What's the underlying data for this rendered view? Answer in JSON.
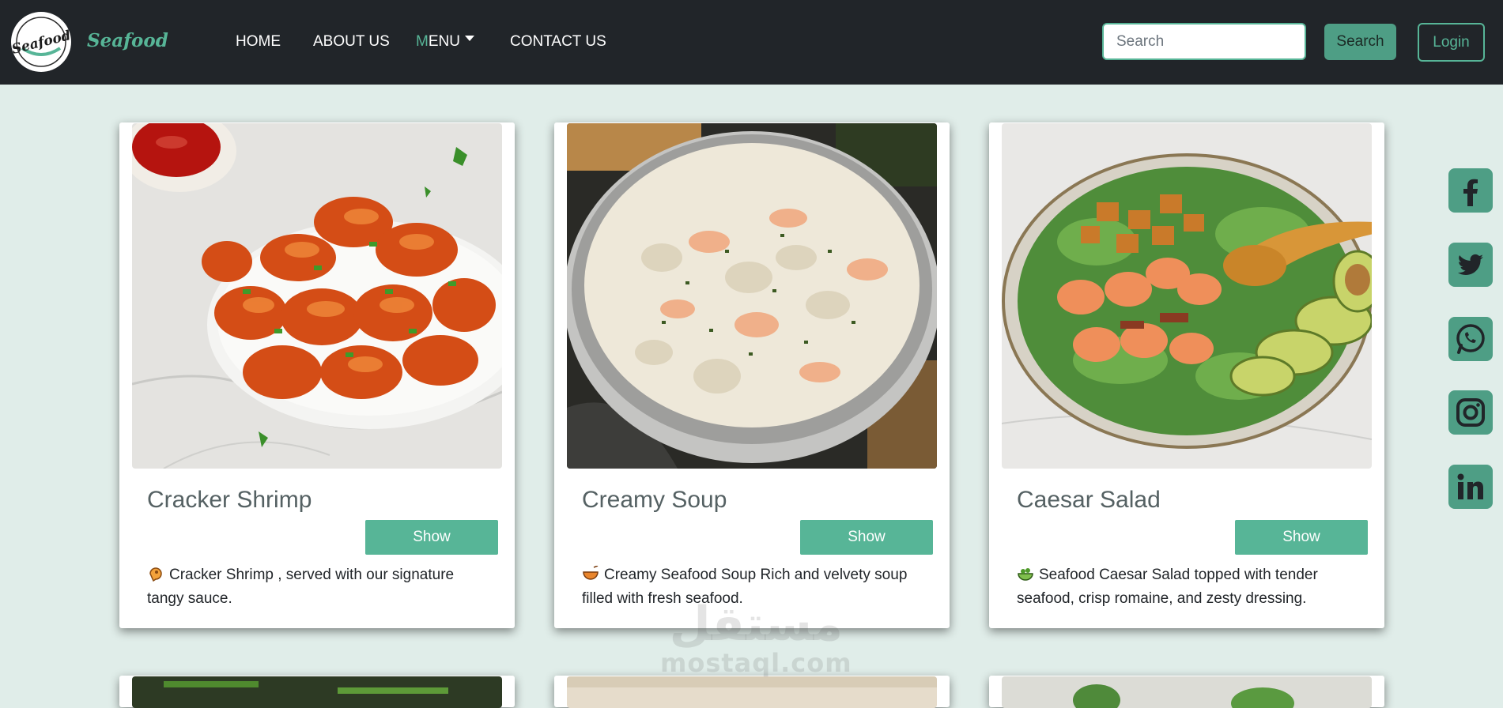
{
  "nav": {
    "brand": "Seafood",
    "logo_text": "Seafood",
    "links": [
      {
        "label": "HOME"
      },
      {
        "label": "ABOUT US"
      },
      {
        "label_first": "M",
        "label_rest": "ENU"
      },
      {
        "label": "CONTACT US"
      }
    ],
    "search_placeholder": "Search",
    "search_button": "Search",
    "login_button": "Login"
  },
  "cards": [
    {
      "title": "Cracker Shrimp",
      "button": "Show",
      "icon": "shrimp-emoji",
      "description": "Cracker Shrimp , served with our signature tangy sauce."
    },
    {
      "title": "Creamy Soup",
      "button": "Show",
      "icon": "soup-emoji",
      "description": "Creamy Seafood Soup Rich and velvety soup filled with fresh seafood."
    },
    {
      "title": "Caesar Salad",
      "button": "Show",
      "icon": "salad-emoji",
      "description": "Seafood Caesar Salad topped with tender seafood, crisp romaine, and zesty dressing."
    }
  ],
  "social": [
    "facebook-icon",
    "twitter-icon",
    "whatsapp-icon",
    "instagram-icon",
    "linkedin-icon"
  ],
  "watermark": {
    "arabic": "مستقل",
    "latin": "mostaql.com"
  },
  "colors": {
    "navbar": "#212529",
    "accent": "#57b597",
    "background": "#e0ede9",
    "title": "#556163"
  }
}
